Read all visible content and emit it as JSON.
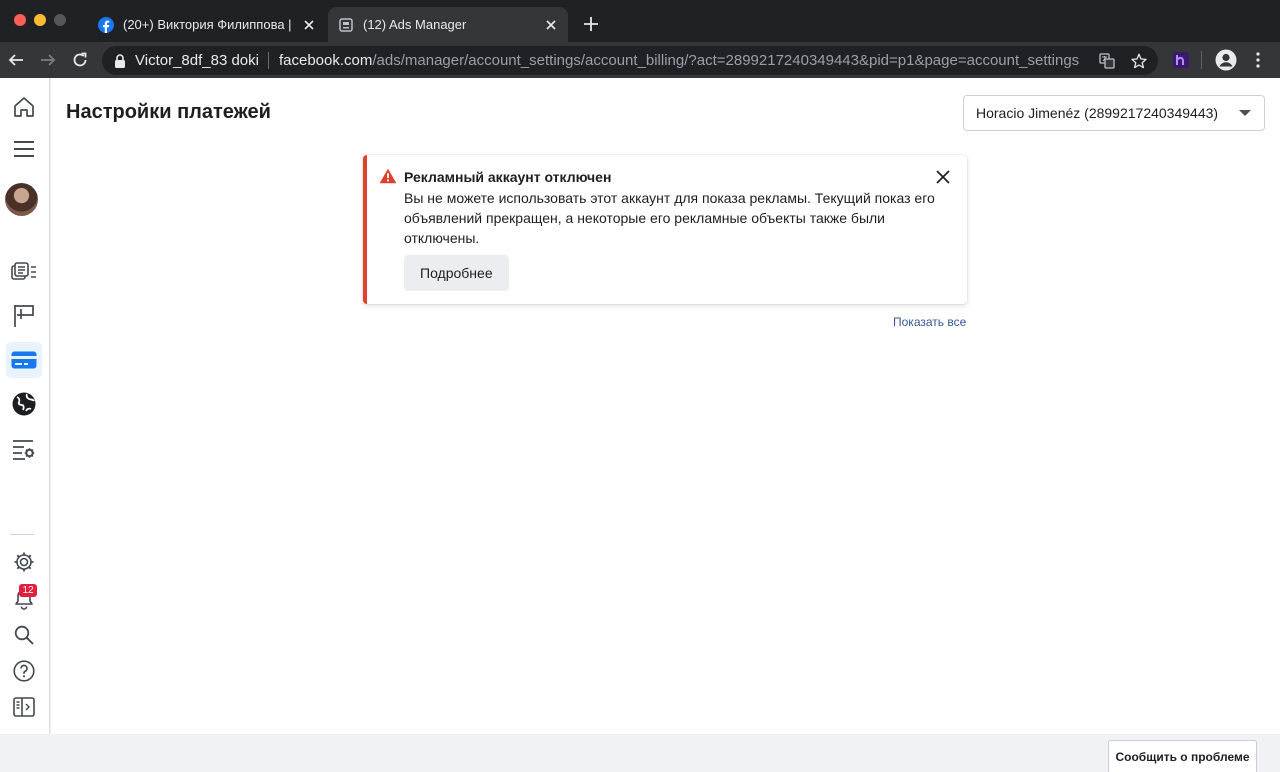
{
  "browser": {
    "tabs": [
      {
        "title": "(20+) Виктория Филиппова | Facebook",
        "favicon": "facebook-icon",
        "active": false
      },
      {
        "title": "(12) Ads Manager",
        "favicon": "ads-manager-icon",
        "active": true
      }
    ],
    "address": {
      "site_label": "Victor_8df_83 doki",
      "url_host": "facebook.com",
      "url_path": "/ads/manager/account_settings/account_billing/?act=2899217240349443&pid=p1&page=account_settings"
    }
  },
  "leftnav": {
    "items": [
      {
        "icon": "home-icon",
        "active": false
      },
      {
        "icon": "menu-icon",
        "active": false
      },
      {
        "icon": "avatar",
        "active": false
      },
      {
        "icon": "campaigns-icon",
        "active": false
      },
      {
        "icon": "flag-icon",
        "active": false
      },
      {
        "icon": "billing-card-icon",
        "active": true
      },
      {
        "icon": "globe-icon",
        "active": false
      },
      {
        "icon": "settings-list-icon",
        "active": false
      },
      {
        "icon": "gear-icon",
        "active": false
      },
      {
        "icon": "bell-icon",
        "active": false
      },
      {
        "icon": "search-icon",
        "active": false
      },
      {
        "icon": "help-icon",
        "active": false
      },
      {
        "icon": "panel-toggle-icon",
        "active": false
      }
    ],
    "notifications_badge": "12"
  },
  "main": {
    "page_title": "Настройки платежей",
    "account_selector": "Horacio Jimenéz (2899217240349443)",
    "alert": {
      "title": "Рекламный аккаунт отключен",
      "body": "Вы не можете использовать этот аккаунт для показа рекламы. Текущий показ его объявлений прекращен, а некоторые его рекламные объекты также были отключены.",
      "button_label": "Подробнее",
      "accent_color": "#e0412d"
    },
    "show_all_link": "Показать все"
  },
  "footer": {
    "report_button": "Сообщить о проблеме"
  }
}
